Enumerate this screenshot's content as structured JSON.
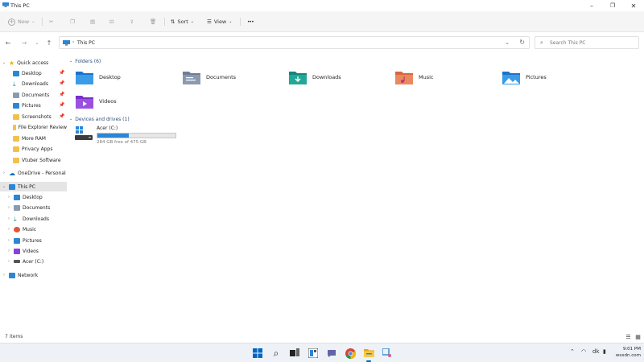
{
  "window": {
    "title": "This PC"
  },
  "toolbar": {
    "new_label": "New",
    "sort_label": "Sort",
    "view_label": "View",
    "more_label": "•••"
  },
  "address": {
    "crumb": "This PC"
  },
  "search": {
    "placeholder": "Search This PC"
  },
  "nav": {
    "quick_access": {
      "label": "Quick access",
      "items": [
        {
          "label": "Desktop",
          "pinned": true
        },
        {
          "label": "Downloads",
          "pinned": true
        },
        {
          "label": "Documents",
          "pinned": true
        },
        {
          "label": "Pictures",
          "pinned": true
        },
        {
          "label": "Screenshots",
          "pinned": true
        },
        {
          "label": "File Explorer Review",
          "pinned": false
        },
        {
          "label": "More RAM",
          "pinned": false
        },
        {
          "label": "Privacy Apps",
          "pinned": false
        },
        {
          "label": "Vtuber Software",
          "pinned": false
        }
      ]
    },
    "onedrive": {
      "label": "OneDrive - Personal"
    },
    "this_pc": {
      "label": "This PC",
      "items": [
        {
          "label": "Desktop"
        },
        {
          "label": "Documents"
        },
        {
          "label": "Downloads"
        },
        {
          "label": "Music"
        },
        {
          "label": "Pictures"
        },
        {
          "label": "Videos"
        },
        {
          "label": "Acer (C:)"
        }
      ]
    },
    "network": {
      "label": "Network"
    }
  },
  "content": {
    "folders_header": "Folders (6)",
    "folders": [
      {
        "name": "Desktop"
      },
      {
        "name": "Documents"
      },
      {
        "name": "Downloads"
      },
      {
        "name": "Music"
      },
      {
        "name": "Pictures"
      },
      {
        "name": "Videos"
      }
    ],
    "devices_header": "Devices and drives (1)",
    "drive": {
      "name": "Acer (C:)",
      "free_text": "284 GB free of 475 GB",
      "used_fraction": 0.4
    }
  },
  "status": {
    "item_count": "7 items"
  },
  "taskbar": {
    "tray_lang": "dk",
    "time": "9:01 PM",
    "date": "wsxdn.com"
  },
  "colors": {
    "accent": "#0067c0",
    "drive_fill": "#2b86d6",
    "folder_yellow": "#f3c14b",
    "folder_blue": "#3a8fd8"
  }
}
